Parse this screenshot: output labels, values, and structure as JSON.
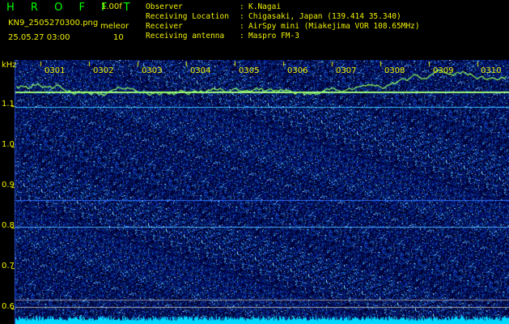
{
  "header": {
    "app_title": "H R O F F T",
    "version": "1.00f",
    "filename": "KN9_2505270300.png",
    "datetime": "25.05.27 03:00",
    "category": "meleor",
    "count": "10"
  },
  "observation": {
    "rows": [
      {
        "label": "Observer",
        "value": "K.Nagai"
      },
      {
        "label": "Receiving Location",
        "value": "Chigasaki, Japan (139.414 35.340)"
      },
      {
        "label": "Receiver",
        "value": "AirSpy mini (Miakejima VOR 108.65MHz)"
      },
      {
        "label": "Receiving antenna",
        "value": "Maspro FM-3"
      }
    ]
  },
  "axis": {
    "unit": "kHz",
    "ticks": [
      "1.1",
      "1.0",
      "0.9",
      "0.8",
      "0.7",
      "0.6"
    ]
  },
  "minute_labels": [
    "0301",
    "0302",
    "0303",
    "0304",
    "0305",
    "0306",
    "0307",
    "0308",
    "0309",
    "0310"
  ],
  "colors": {
    "background": "#000000",
    "text": "#f0f000",
    "title": "#00ff00",
    "noise_dark": "#0a1a6a",
    "carrier": "#80ff80",
    "trace": "#90ff60",
    "floor": "#00e0ff"
  }
}
